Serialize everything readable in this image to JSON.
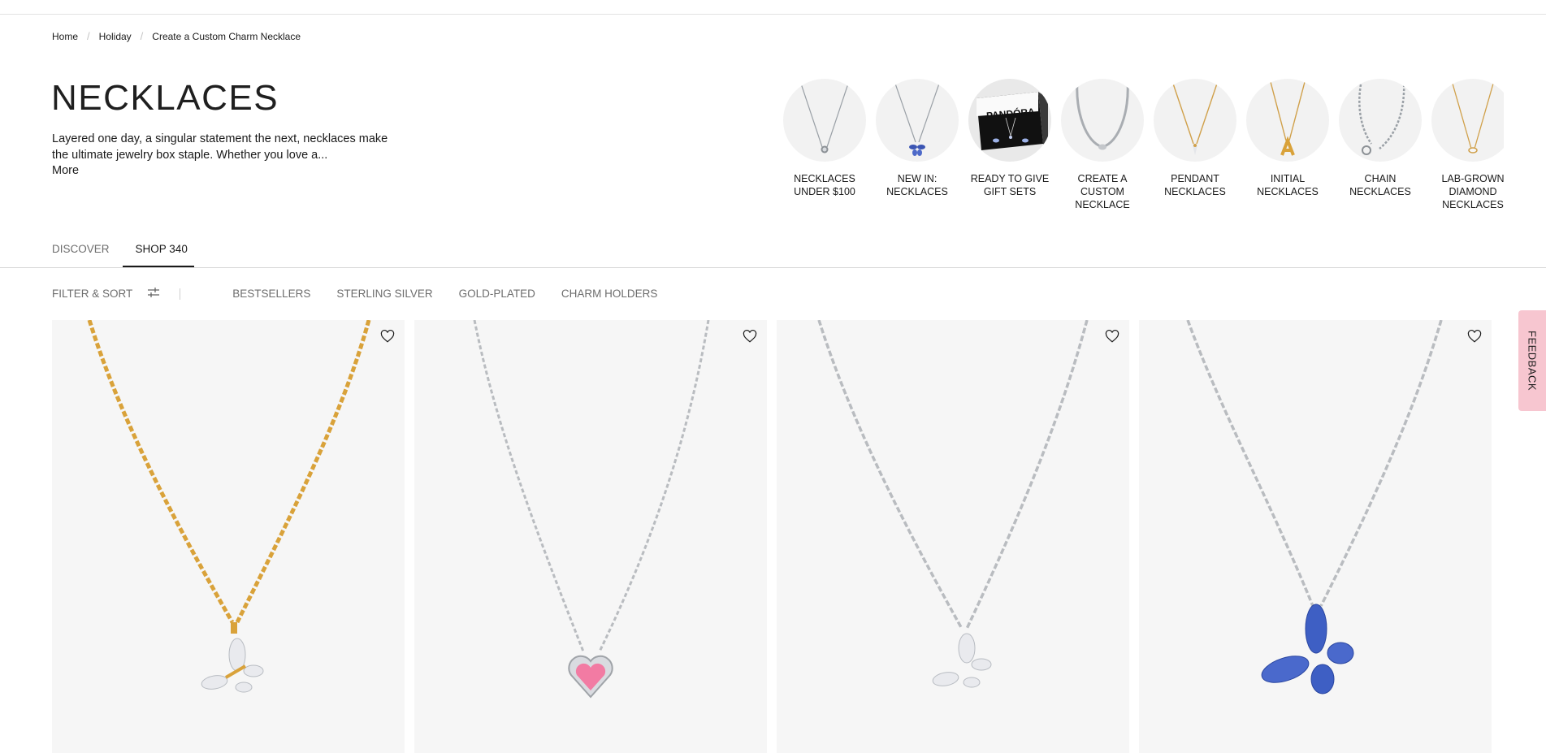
{
  "breadcrumb": [
    "Home",
    "Holiday",
    "Create a Custom Charm Necklace"
  ],
  "page_title": "NECKLACES",
  "description": "Layered one day, a singular statement the next, necklaces make the ultimate jewelry box staple. Whether you love a...",
  "more_label": "More",
  "categories": [
    {
      "label": "NECKLACES UNDER $100",
      "icon": "silver-pendant-necklace"
    },
    {
      "label": "NEW IN: NECKLACES",
      "icon": "blue-butterfly-necklace"
    },
    {
      "label": "READY TO GIVE GIFT SETS",
      "icon": "gift-box",
      "box_text": "PANDÓRA"
    },
    {
      "label": "CREATE A CUSTOM NECKLACE",
      "icon": "snake-chain-necklace"
    },
    {
      "label": "PENDANT NECKLACES",
      "icon": "gold-pendant-necklace"
    },
    {
      "label": "INITIAL NECKLACES",
      "icon": "gold-initial-necklace"
    },
    {
      "label": "CHAIN NECKLACES",
      "icon": "silver-chain-necklace"
    },
    {
      "label": "LAB-GROWN DIAMOND NECKLACES",
      "icon": "gold-diamond-necklace"
    }
  ],
  "tabs": [
    {
      "label": "DISCOVER",
      "active": false
    },
    {
      "label": "SHOP",
      "count": "340",
      "active": true
    }
  ],
  "filter": {
    "label": "FILTER & SORT",
    "icon": "sliders-icon"
  },
  "chips": [
    "BESTSELLERS",
    "STERLING SILVER",
    "GOLD-PLATED",
    "CHARM HOLDERS"
  ],
  "products": [
    {
      "name": "gold-butterfly-necklace",
      "chain_color": "#d9a23a"
    },
    {
      "name": "pink-heart-necklace",
      "chain_color": "#b9bcc0"
    },
    {
      "name": "silver-butterfly-necklace",
      "chain_color": "#b9bcc0"
    },
    {
      "name": "blue-butterfly-necklace",
      "chain_color": "#b9bcc0"
    }
  ],
  "feedback_label": "FEEDBACK",
  "colors": {
    "accent": "#1a1a1a",
    "feedback_bg": "#f7c6d0",
    "card_bg": "#f6f6f6"
  }
}
